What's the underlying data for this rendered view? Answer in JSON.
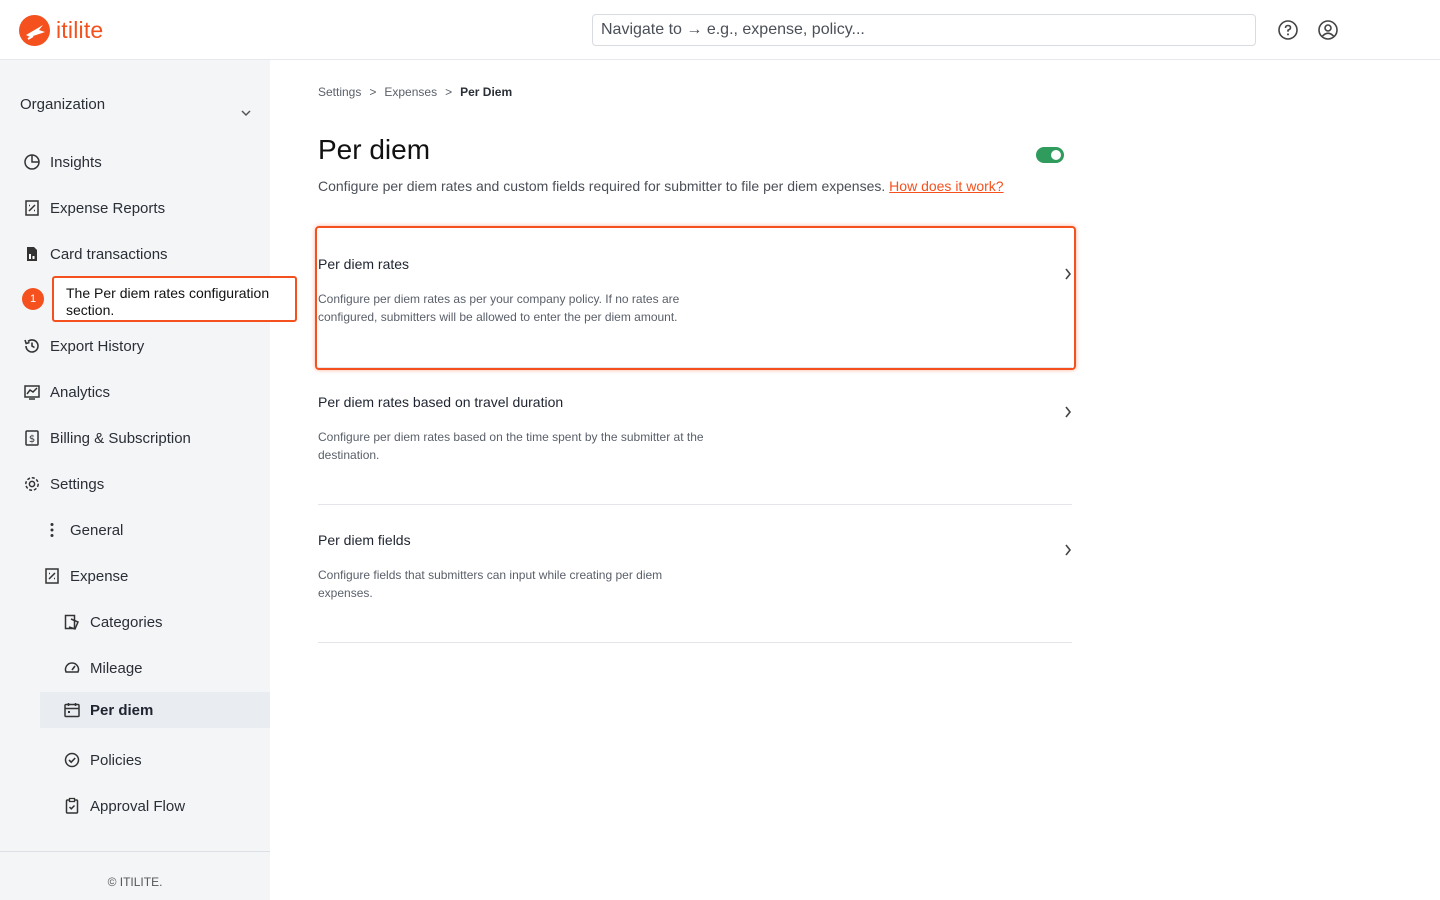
{
  "header": {
    "logo_text": "itilite",
    "search_placeholder": "Navigate to → e.g., expense, policy...",
    "accent_color": "#f4511e"
  },
  "sidebar": {
    "org_label": "Organization",
    "items": [
      {
        "label": "Insights",
        "icon": "pie-chart-icon"
      },
      {
        "label": "Expense Reports",
        "icon": "receipt-icon"
      },
      {
        "label": "Card transactions",
        "icon": "card-doc-icon"
      },
      {
        "label": "Export History",
        "icon": "history-icon"
      },
      {
        "label": "Analytics",
        "icon": "analytics-icon"
      },
      {
        "label": "Billing & Subscription",
        "icon": "billing-icon"
      },
      {
        "label": "Settings",
        "icon": "gear-icon"
      },
      {
        "label": "General",
        "icon": "dots-vertical-icon"
      },
      {
        "label": "Expense",
        "icon": "receipt-icon"
      },
      {
        "label": "Categories",
        "icon": "categories-icon"
      },
      {
        "label": "Mileage",
        "icon": "gauge-icon"
      },
      {
        "label": "Per diem",
        "icon": "calendar-icon"
      },
      {
        "label": "Policies",
        "icon": "check-circle-icon"
      },
      {
        "label": "Approval Flow",
        "icon": "clipboard-check-icon"
      }
    ],
    "active_item": "Per diem",
    "footer": "© ITILITE."
  },
  "tooltip": {
    "number": "1",
    "text": "The Per diem rates configuration section."
  },
  "breadcrumb": [
    "Settings",
    ">",
    "Expenses",
    ">",
    "Per Diem"
  ],
  "page": {
    "title": "Per diem",
    "enabled": true,
    "description": "Configure per diem rates and custom fields required for submitter to file per diem expenses.",
    "help_link": "How does it work?"
  },
  "cards": [
    {
      "title": "Per diem rates",
      "description": "Configure per diem rates as per your company policy. If no rates are configured, submitters will be allowed to enter the per diem amount."
    },
    {
      "title": "Per diem rates based on travel duration",
      "description": "Configure per diem rates based on the time spent by the submitter at the destination."
    },
    {
      "title": "Per diem fields",
      "description": "Configure fields that submitters can input while creating per diem expenses."
    }
  ]
}
